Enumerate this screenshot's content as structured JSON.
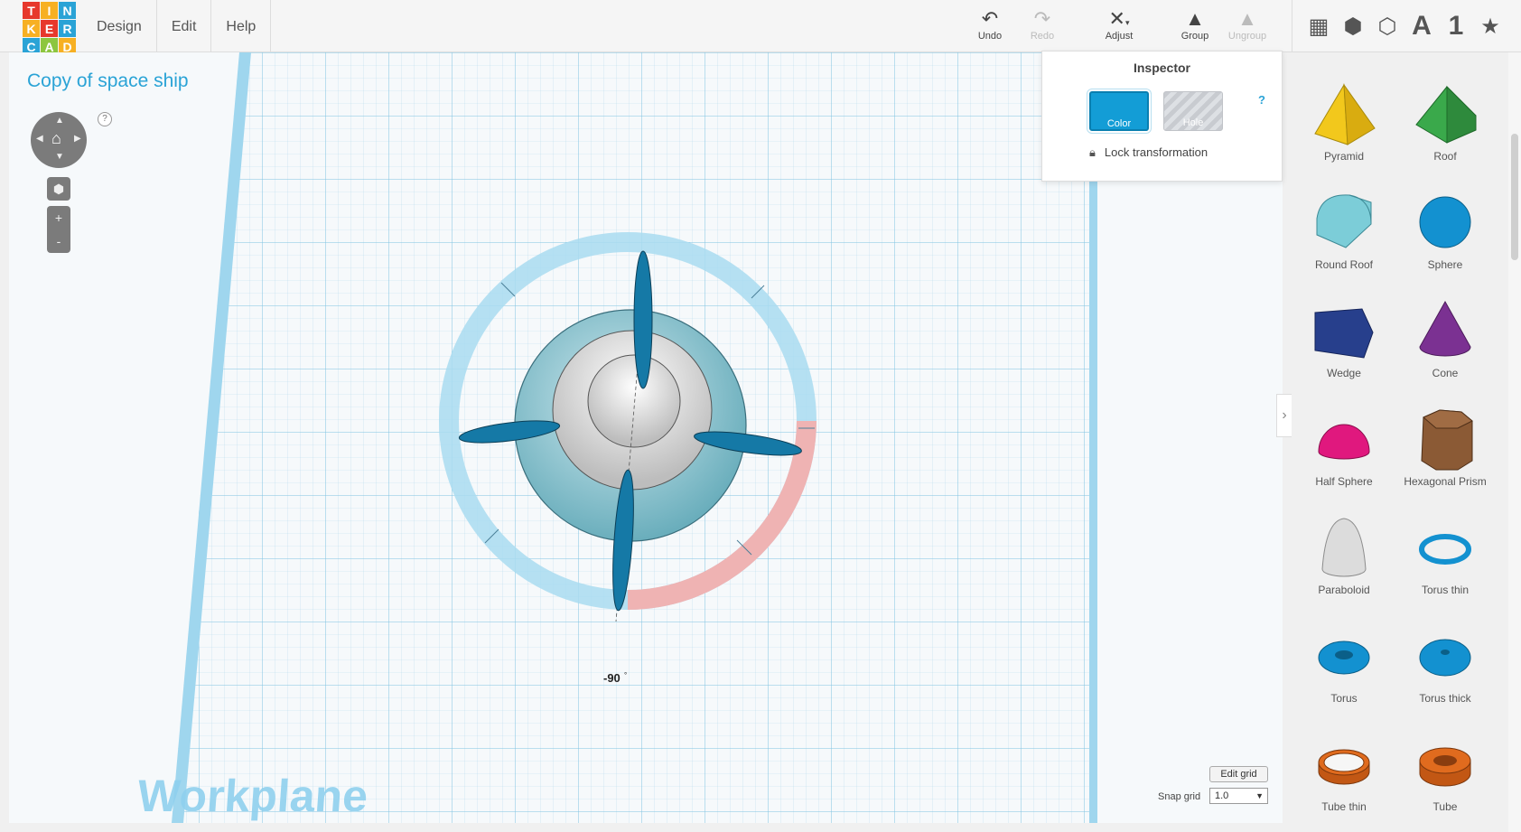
{
  "logo": {
    "letters": [
      "T",
      "I",
      "N",
      "K",
      "E",
      "R",
      "C",
      "A",
      "D"
    ],
    "colors": [
      "#e7382c",
      "#f7b023",
      "#2aa3d6",
      "#f7b023",
      "#e7382c",
      "#2aa3d6",
      "#2aa3d6",
      "#8dc63f",
      "#f7b023"
    ]
  },
  "menu": {
    "design": "Design",
    "edit": "Edit",
    "help": "Help"
  },
  "toolbar": {
    "undo": "Undo",
    "redo": "Redo",
    "adjust": "Adjust",
    "group": "Group",
    "ungroup": "Ungroup"
  },
  "view_icons": [
    "grid-view-icon",
    "cube-icon",
    "cube-wireframe-icon",
    "A",
    "1",
    "star-icon"
  ],
  "document": {
    "title": "Copy of space ship"
  },
  "navigator": {
    "help": "?",
    "zoom_in": "+",
    "zoom_out": "-"
  },
  "inspector": {
    "title": "Inspector",
    "help": "?",
    "color_label": "Color",
    "hole_label": "Hole",
    "lock_label": "Lock transformation"
  },
  "workplane": {
    "label": "Workplane",
    "rotation_readout": "-90",
    "rotation_unit": "°"
  },
  "grid": {
    "edit_button": "Edit grid",
    "snap_label": "Snap grid",
    "snap_value": "1.0"
  },
  "shapes": [
    {
      "name": "Pyramid",
      "color": "#f2c81c"
    },
    {
      "name": "Roof",
      "color": "#3aa94b"
    },
    {
      "name": "Round Roof",
      "color": "#7ccdd8"
    },
    {
      "name": "Sphere",
      "color": "#1391d0"
    },
    {
      "name": "Wedge",
      "color": "#273f8c"
    },
    {
      "name": "Cone",
      "color": "#7b3192"
    },
    {
      "name": "Half Sphere",
      "color": "#e0187e"
    },
    {
      "name": "Hexagonal Prism",
      "color": "#8b5a35"
    },
    {
      "name": "Paraboloid",
      "color": "#cfcfcf"
    },
    {
      "name": "Torus thin",
      "color": "#1391d0"
    },
    {
      "name": "Torus",
      "color": "#1391d0"
    },
    {
      "name": "Torus thick",
      "color": "#1391d0"
    },
    {
      "name": "Tube thin",
      "color": "#e06b1e"
    },
    {
      "name": "Tube",
      "color": "#e06b1e"
    }
  ],
  "colors": {
    "accent": "#2aa3d6",
    "selection": "#139dd6",
    "rotation_handle": "#f0a3a3"
  }
}
